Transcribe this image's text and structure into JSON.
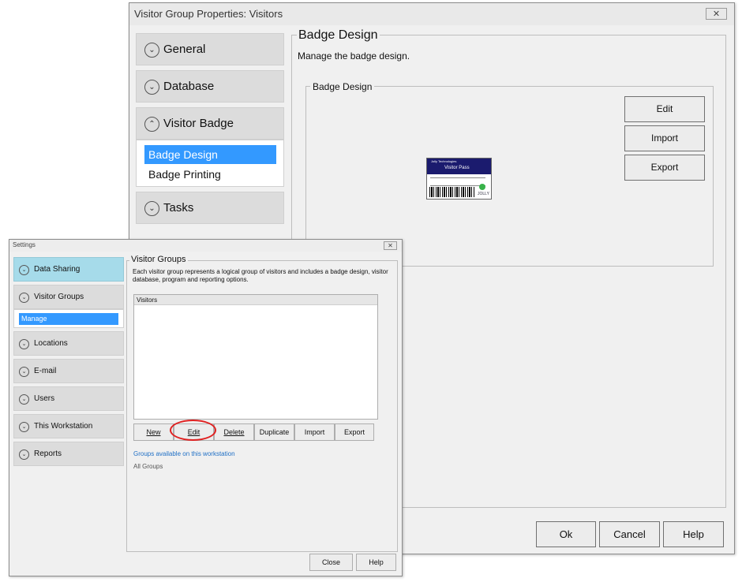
{
  "props": {
    "title": "Visitor Group Properties: Visitors",
    "nav": [
      {
        "label": "General"
      },
      {
        "label": "Database"
      },
      {
        "label": "Visitor Badge",
        "children": [
          "Badge Design",
          "Badge Printing"
        ]
      },
      {
        "label": "Tasks"
      }
    ],
    "section_title": "Badge Design",
    "section_desc": "Manage the badge design.",
    "group_label": "Badge Design",
    "buttons": {
      "edit": "Edit",
      "import": "Import",
      "export": "Export"
    },
    "footer": {
      "ok": "Ok",
      "cancel": "Cancel",
      "help": "Help"
    },
    "badge_preview": {
      "company": "Jolly Technologies",
      "title": "Visitor Pass",
      "logo": "JOLLY"
    }
  },
  "settings": {
    "title": "Settings",
    "nav": [
      {
        "label": "Data Sharing",
        "active": true
      },
      {
        "label": "Visitor Groups",
        "children": [
          "Manage"
        ]
      },
      {
        "label": "Locations"
      },
      {
        "label": "E-mail"
      },
      {
        "label": "Users"
      },
      {
        "label": "This Workstation"
      },
      {
        "label": "Reports"
      }
    ],
    "section_title": "Visitor Groups",
    "section_desc": "Each visitor group represents a logical group of visitors and includes a badge design, visitor database, program and reporting options.",
    "list_items": [
      "Visitors"
    ],
    "buttons": {
      "new": "New",
      "edit": "Edit",
      "delete": "Delete",
      "duplicate": "Duplicate",
      "import": "Import",
      "export": "Export"
    },
    "link": "Groups available on this workstation",
    "all_groups": "All Groups",
    "footer": {
      "close": "Close",
      "help": "Help"
    }
  },
  "colors": {
    "selection": "#3399ff",
    "active_nav": "#a6dbea",
    "highlight_circle": "#e02020",
    "link": "#1f6fc5"
  }
}
